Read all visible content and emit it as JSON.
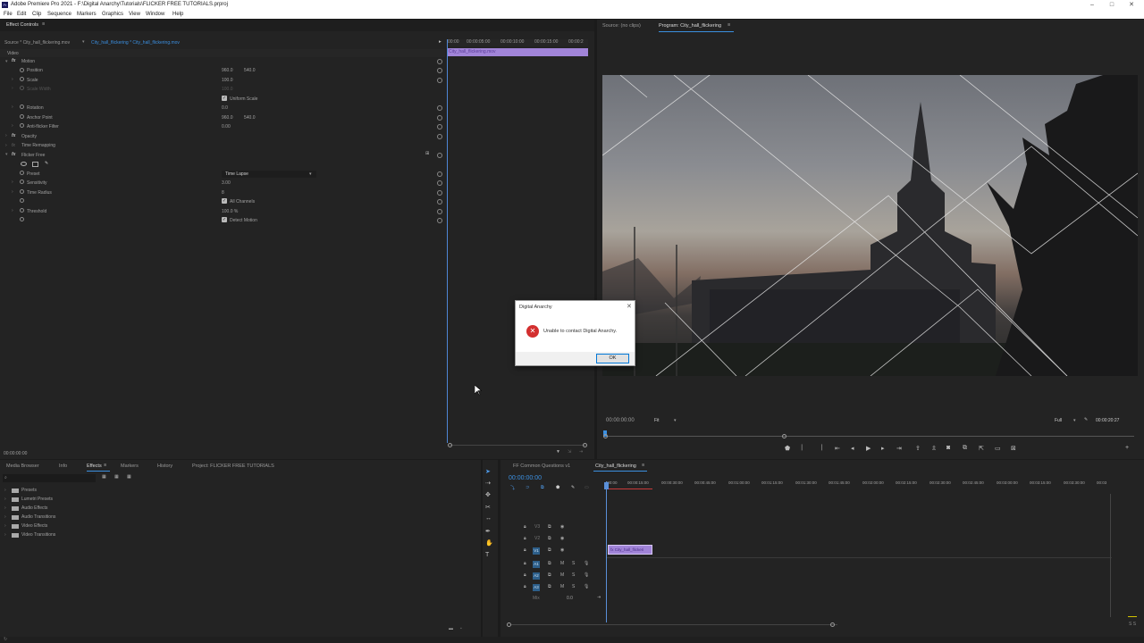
{
  "app": {
    "title": "Adobe Premiere Pro 2021 - F:\\Digital Anarchy\\Tutorials\\FLICKER FREE TUTORIALS.prproj",
    "minimize": "–",
    "maximize": "□",
    "close": "✕"
  },
  "menu": [
    "File",
    "Edit",
    "Clip",
    "Sequence",
    "Markers",
    "Graphics",
    "View",
    "Window",
    "Help"
  ],
  "effect_controls": {
    "tab": "Effect Controls",
    "source_label": "Source * City_hall_flickering.mov",
    "sequence_label": "City_hall_flickering * City_hall_flickering.mov",
    "video_header": "Video",
    "timecodes": [
      "00:00",
      "00:00:05:00",
      "00:00:10:00",
      "00:00:15:00",
      "00:00:2"
    ],
    "clip_name": "City_hall_flickering.mov",
    "current_time": "00:00:00:00",
    "motion": "Motion",
    "position": {
      "label": "Position",
      "x": "960.0",
      "y": "540.0"
    },
    "scale": {
      "label": "Scale",
      "value": "100.0"
    },
    "scale_width": {
      "label": "Scale Width",
      "value": "100.0"
    },
    "uniform_scale": "Uniform Scale",
    "rotation": {
      "label": "Rotation",
      "value": "0.0"
    },
    "anchor_point": {
      "label": "Anchor Point",
      "x": "960.0",
      "y": "540.0"
    },
    "anti_flicker": {
      "label": "Anti-flicker Filter",
      "value": "0.00"
    },
    "opacity": "Opacity",
    "time_remapping": "Time Remapping",
    "flicker_free": "Flicker Free",
    "preset": {
      "label": "Preset",
      "value": "Time Lapse"
    },
    "sensitivity": {
      "label": "Sensitivity",
      "value": "3.00"
    },
    "time_radius": {
      "label": "Time Radius",
      "value": "8"
    },
    "all_channels": "All Channels",
    "threshold": {
      "label": "Threshold",
      "value": "100.0 %"
    },
    "detect_motion": "Detect Motion"
  },
  "program_monitor": {
    "source_tab": "Source: (no clips)",
    "program_tab": "Program: City_hall_flickering",
    "timecode": "00:00:00:00",
    "zoom": "Fit",
    "resolution": "Full",
    "duration": "00:00:20:27"
  },
  "dialog": {
    "title": "Digital Anarchy",
    "message": "Unable to contact Digital Anarchy.",
    "ok": "OK"
  },
  "effects_panel": {
    "tabs": [
      "Media Browser",
      "Info",
      "Effects",
      "Markers",
      "History",
      "Project: FLICKER FREE TUTORIALS"
    ],
    "folders": [
      "Presets",
      "Lumetri Presets",
      "Audio Effects",
      "Audio Transitions",
      "Video Effects",
      "Video Transitions"
    ]
  },
  "timeline": {
    "tabs": [
      "FF Common Questions v1",
      "City_hall_flickering"
    ],
    "timecode": "00:00:00:00",
    "ruler": [
      ":00:00",
      "00:00:15:00",
      "00:00:30:00",
      "00:00:45:00",
      "00:01:00:00",
      "00:01:15:00",
      "00:01:30:00",
      "00:01:45:00",
      "00:02:00:00",
      "00:02:15:00",
      "00:02:30:00",
      "00:02:45:00",
      "00:03:00:00",
      "00:03:15:00",
      "00:03:30:00",
      "00:03"
    ],
    "video_tracks": [
      "V3",
      "V2",
      "V1"
    ],
    "audio_tracks": [
      "A1",
      "A2",
      "A3"
    ],
    "mix_label": "Mix",
    "mix_value": "0.0",
    "clip_label": "fx City_hall_flickeri"
  },
  "colors": {
    "accent": "#3b8fe0",
    "clip_purple": "#a184d8",
    "error_red": "#d32f2f",
    "playhead": "#5a8fd8"
  }
}
